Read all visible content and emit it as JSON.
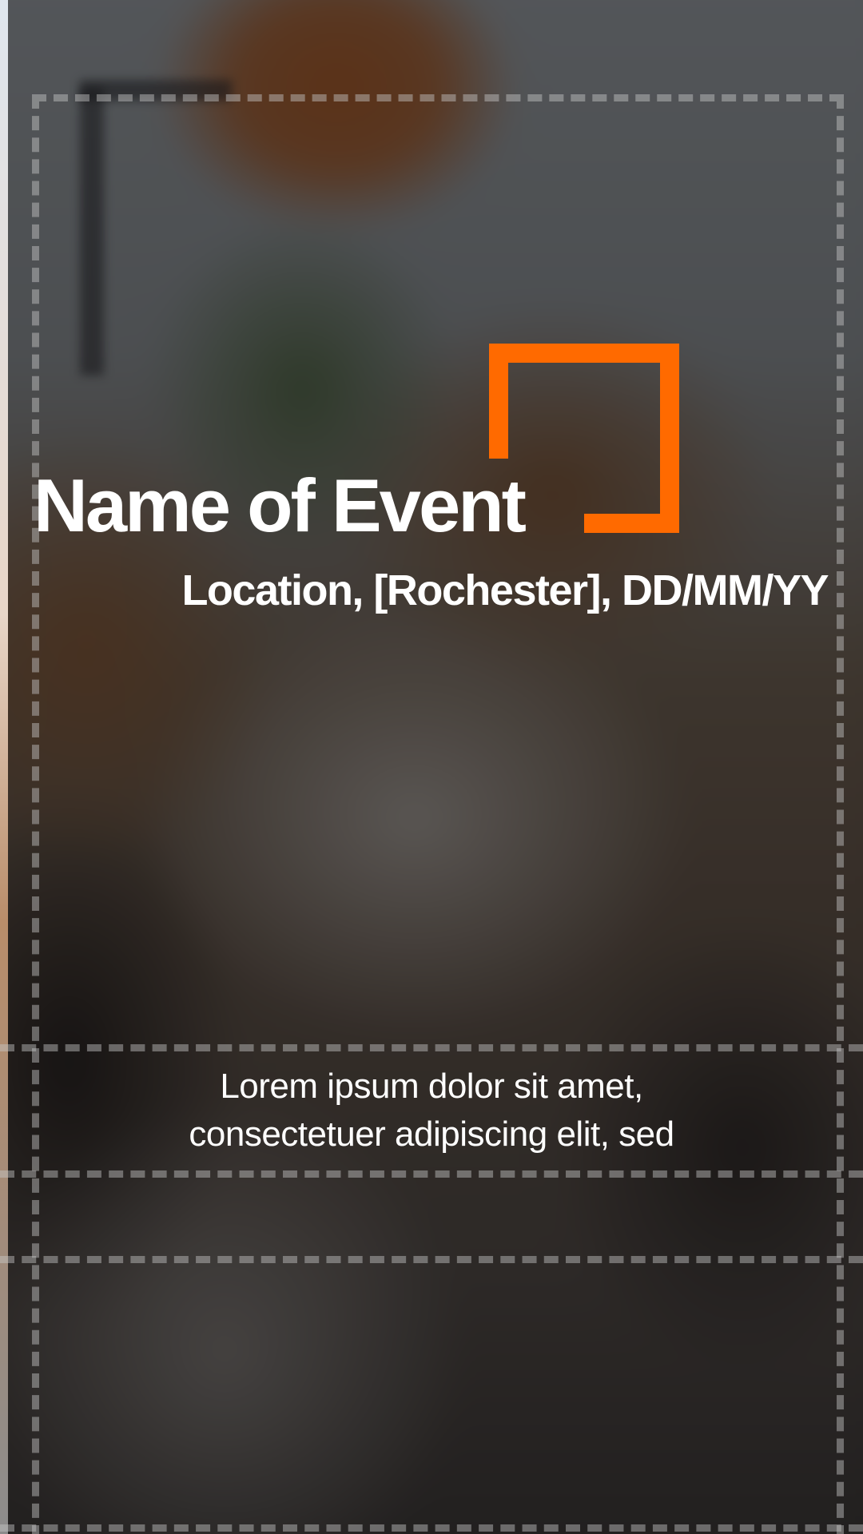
{
  "event": {
    "title": "Name of Event",
    "subtitle": "Location, [Rochester], DD/MM/YY"
  },
  "body": {
    "line1": "Lorem ipsum dolor sit amet,",
    "line2": "consectetuer adipiscing elit, sed"
  },
  "colors": {
    "accent": "#ff6a00",
    "text": "#ffffff"
  }
}
